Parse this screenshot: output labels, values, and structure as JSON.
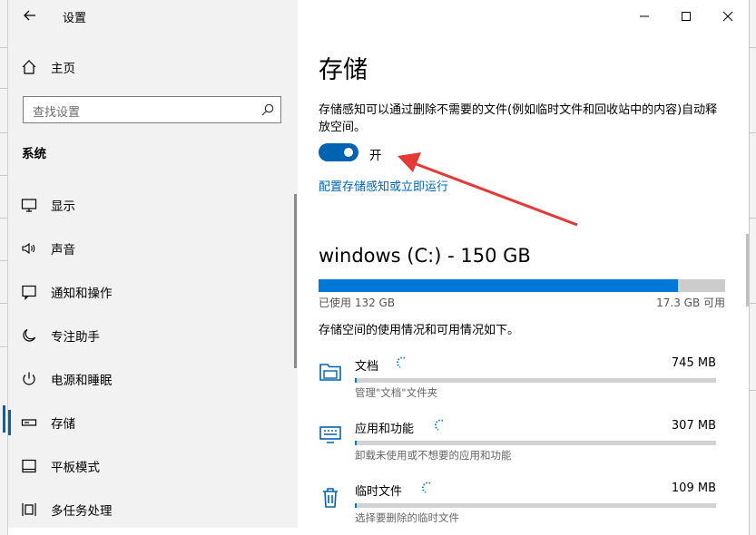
{
  "window": {
    "title": "设置"
  },
  "sidebar": {
    "home_label": "主页",
    "search_placeholder": "查找设置",
    "section_title": "系统",
    "items": [
      {
        "label": "显示",
        "icon": "monitor-icon"
      },
      {
        "label": "声音",
        "icon": "speaker-icon"
      },
      {
        "label": "通知和操作",
        "icon": "notification-icon"
      },
      {
        "label": "专注助手",
        "icon": "moon-icon"
      },
      {
        "label": "电源和睡眠",
        "icon": "power-icon"
      },
      {
        "label": "存储",
        "icon": "storage-icon",
        "active": true
      },
      {
        "label": "平板模式",
        "icon": "tablet-icon"
      },
      {
        "label": "多任务处理",
        "icon": "multitask-icon"
      }
    ]
  },
  "main": {
    "title": "存储",
    "description": "存储感知可以通过删除不需要的文件(例如临时文件和回收站中的内容)自动释放空间。",
    "toggle": {
      "state": "on",
      "label": "开"
    },
    "configure_link": "配置存储感知或立即运行",
    "drive": {
      "title": "windows (C:) - 150 GB",
      "used_label": "已使用 132 GB",
      "available_label": "17.3 GB 可用",
      "used_fraction": 0.885
    },
    "usage_description": "存储空间的使用情况和可用情况如下。",
    "categories": [
      {
        "name": "文档",
        "size": "745 MB",
        "subtitle": "管理\"文档\"文件夹",
        "icon": "folder-icon",
        "fill_fraction": 0.005
      },
      {
        "name": "应用和功能",
        "size": "307 MB",
        "subtitle": "卸载未使用或不想要的应用和功能",
        "icon": "apps-icon",
        "fill_fraction": 0.002
      },
      {
        "name": "临时文件",
        "size": "109 MB",
        "subtitle": "选择要删除的临时文件",
        "icon": "trash-icon",
        "fill_fraction": 0.001
      }
    ]
  },
  "colors": {
    "accent": "#0063b1",
    "bar_fill": "#0078d7",
    "annotation": "#e53935"
  }
}
